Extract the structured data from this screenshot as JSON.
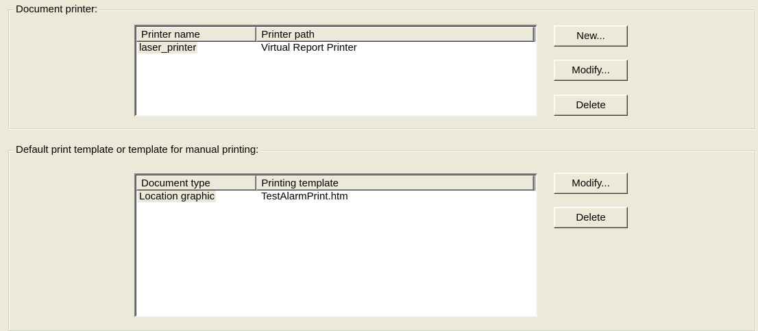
{
  "document_printer": {
    "legend": "Document printer:",
    "columns": [
      "Printer name",
      "Printer path"
    ],
    "rows": [
      {
        "name": "laser_printer",
        "path": "Virtual Report Printer"
      }
    ],
    "buttons": {
      "new": "New...",
      "modify": "Modify...",
      "delete": "Delete"
    }
  },
  "print_template": {
    "legend": "Default print template or template for manual printing:",
    "columns": [
      "Document type",
      "Printing template"
    ],
    "rows": [
      {
        "type": "Location graphic",
        "template": "TestAlarmPrint.htm"
      }
    ],
    "buttons": {
      "modify": "Modify...",
      "delete": "Delete"
    }
  }
}
